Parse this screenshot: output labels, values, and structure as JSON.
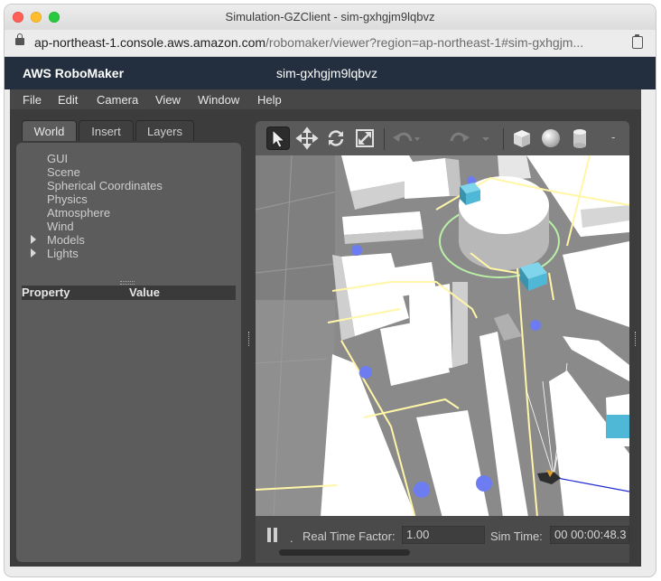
{
  "window": {
    "title": "Simulation-GZClient - sim-gxhgjm9lqbvz"
  },
  "urlbar": {
    "host": "ap-northeast-1.console.aws.amazon.com",
    "path": "/robomaker/viewer?region=ap-northeast-1#sim-gxhgjm..."
  },
  "aws_header": {
    "brand": "AWS RoboMaker",
    "simulation_id": "sim-gxhgjm9lqbvz"
  },
  "menu": {
    "items": [
      "File",
      "Edit",
      "Camera",
      "View",
      "Window",
      "Help"
    ]
  },
  "left_panel": {
    "tabs": [
      {
        "label": "World",
        "active": true
      },
      {
        "label": "Insert",
        "active": false
      },
      {
        "label": "Layers",
        "active": false
      }
    ],
    "tree": [
      {
        "label": "GUI",
        "expandable": false
      },
      {
        "label": "Scene",
        "expandable": false
      },
      {
        "label": "Spherical Coordinates",
        "expandable": false
      },
      {
        "label": "Physics",
        "expandable": false
      },
      {
        "label": "Atmosphere",
        "expandable": false
      },
      {
        "label": "Wind",
        "expandable": false
      },
      {
        "label": "Models",
        "expandable": true
      },
      {
        "label": "Lights",
        "expandable": true
      }
    ],
    "property_header": {
      "property": "Property",
      "value": "Value"
    }
  },
  "toolbar": {
    "tools": [
      "select-mode",
      "translate-mode",
      "rotate-mode",
      "scale-mode",
      "undo",
      "redo",
      "box-shape",
      "sphere-shape",
      "cylinder-shape"
    ],
    "more": "-"
  },
  "bottom_bar": {
    "step": ".",
    "real_time_factor_label": "Real Time Factor:",
    "real_time_factor_value": "1.00",
    "sim_time_label": "Sim Time:",
    "sim_time_value": "00 00:00:48.3"
  },
  "colors": {
    "aws_header": "#232f3e",
    "road_line": "#fff6a8",
    "waypoint": "#6d7cf0",
    "robot_cube": "#4fb8d6"
  }
}
